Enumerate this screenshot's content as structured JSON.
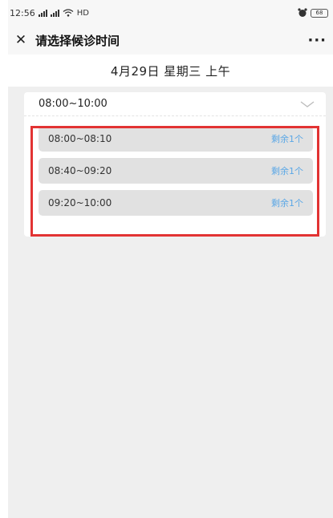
{
  "status_bar": {
    "time": "12:56",
    "network_label": "HD",
    "battery": "68"
  },
  "nav": {
    "close_glyph": "✕",
    "title": "请选择候诊时间",
    "more_glyph": "···"
  },
  "date_header": "4月29日 星期三 上午",
  "period": {
    "label": "08:00~10:00",
    "slots": [
      {
        "time": "08:00~08:10",
        "remain": "剩余1个"
      },
      {
        "time": "08:40~09:20",
        "remain": "剩余1个"
      },
      {
        "time": "09:20~10:00",
        "remain": "剩余1个"
      }
    ]
  },
  "colors": {
    "highlight": "#e23333",
    "remain_text": "#5aa7e6",
    "slot_bg": "#e1e1e1",
    "page_bg": "#efefef"
  }
}
